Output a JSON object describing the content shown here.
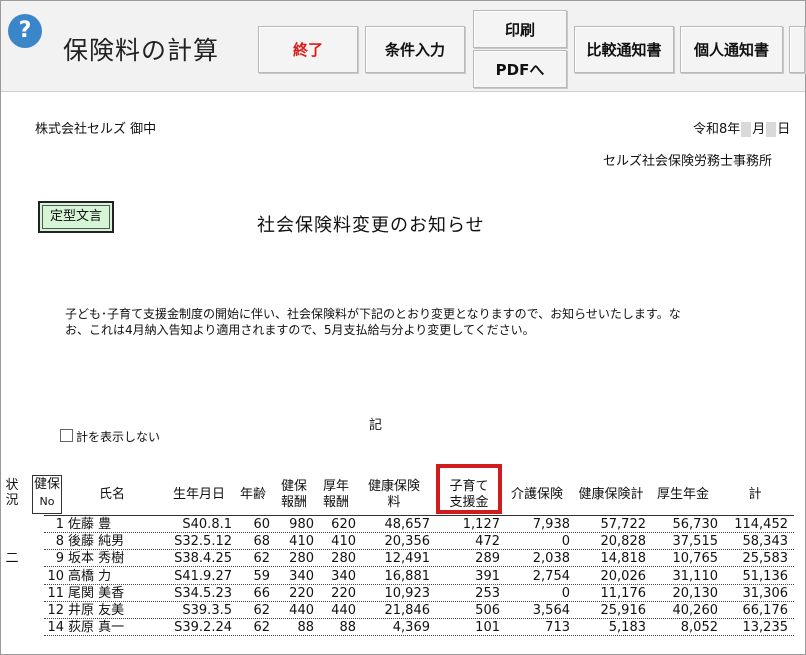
{
  "app": {
    "title": "保険料の計算",
    "help_icon_glyph": "?"
  },
  "toolbar": {
    "end_label": "終了",
    "condition_label": "条件入力",
    "print_label": "印刷",
    "pdf_label": "PDFへ",
    "compare_label": "比較通知書",
    "personal_label": "個人通知書"
  },
  "letter": {
    "recipient": "株式会社セルズ 御中",
    "date_era": "令和8年",
    "date_month": "月",
    "date_day": "日",
    "sender": "セルズ社会保険労務士事務所",
    "template_button": "定型文言",
    "subject": "社会保険料変更のお知らせ",
    "body_line1": "子ども･子育て支援金制度の開始に伴い、社会保険料が下記のとおり変更となりますので、お知らせいたします。な",
    "body_line2": "お、これは4月納入告知より適用されますので、5月支払給与分より変更してください。",
    "ki": "記",
    "hide_total_label": "計を表示しない"
  },
  "table": {
    "headers": {
      "status": "状況",
      "kenpo_no_1": "健保",
      "kenpo_no_2": "No",
      "name": "氏名",
      "birth": "生年月日",
      "age": "年齢",
      "kenpo_hoshu_1": "健保",
      "kenpo_hoshu_2": "報酬",
      "kosei_hoshu_1": "厚年",
      "kosei_hoshu_2": "報酬",
      "kenpo_premium_1": "健康保険",
      "kenpo_premium_2": "料",
      "kodomo_1": "子育て",
      "kodomo_2": "支援金",
      "kaigo": "介護保険",
      "kenpo_total": "健康保険計",
      "kosei": "厚生年金",
      "total": "計"
    },
    "highlight_color": "#d01c1c",
    "rows": [
      {
        "status": "",
        "no": "1",
        "name": "佐藤 豊",
        "birth": "S40.8.1",
        "age": "60",
        "kh": "980",
        "ah": "620",
        "kp": "48,657",
        "kodomo": "1,127",
        "kaigo": "7,938",
        "ktotal": "57,722",
        "kosei": "56,730",
        "total": "114,452"
      },
      {
        "status": "",
        "no": "8",
        "name": "後藤 純男",
        "birth": "S32.5.12",
        "age": "68",
        "kh": "410",
        "ah": "410",
        "kp": "20,356",
        "kodomo": "472",
        "kaigo": "0",
        "ktotal": "20,828",
        "kosei": "37,515",
        "total": "58,343"
      },
      {
        "status": "二",
        "no": "9",
        "name": "坂本 秀樹",
        "birth": "S38.4.25",
        "age": "62",
        "kh": "280",
        "ah": "280",
        "kp": "12,491",
        "kodomo": "289",
        "kaigo": "2,038",
        "ktotal": "14,818",
        "kosei": "10,765",
        "total": "25,583"
      },
      {
        "status": "",
        "no": "10",
        "name": "高橋 力",
        "birth": "S41.9.27",
        "age": "59",
        "kh": "340",
        "ah": "340",
        "kp": "16,881",
        "kodomo": "391",
        "kaigo": "2,754",
        "ktotal": "20,026",
        "kosei": "31,110",
        "total": "51,136"
      },
      {
        "status": "",
        "no": "11",
        "name": "尾関 美香",
        "birth": "S34.5.23",
        "age": "66",
        "kh": "220",
        "ah": "220",
        "kp": "10,923",
        "kodomo": "253",
        "kaigo": "0",
        "ktotal": "11,176",
        "kosei": "20,130",
        "total": "31,306"
      },
      {
        "status": "",
        "no": "12",
        "name": "井原 友美",
        "birth": "S39.3.5",
        "age": "62",
        "kh": "440",
        "ah": "440",
        "kp": "21,846",
        "kodomo": "506",
        "kaigo": "3,564",
        "ktotal": "25,916",
        "kosei": "40,260",
        "total": "66,176"
      },
      {
        "status": "",
        "no": "14",
        "name": "荻原 真一",
        "birth": "S39.2.24",
        "age": "62",
        "kh": "88",
        "ah": "88",
        "kp": "4,369",
        "kodomo": "101",
        "kaigo": "713",
        "ktotal": "5,183",
        "kosei": "8,052",
        "total": "13,235"
      }
    ]
  }
}
